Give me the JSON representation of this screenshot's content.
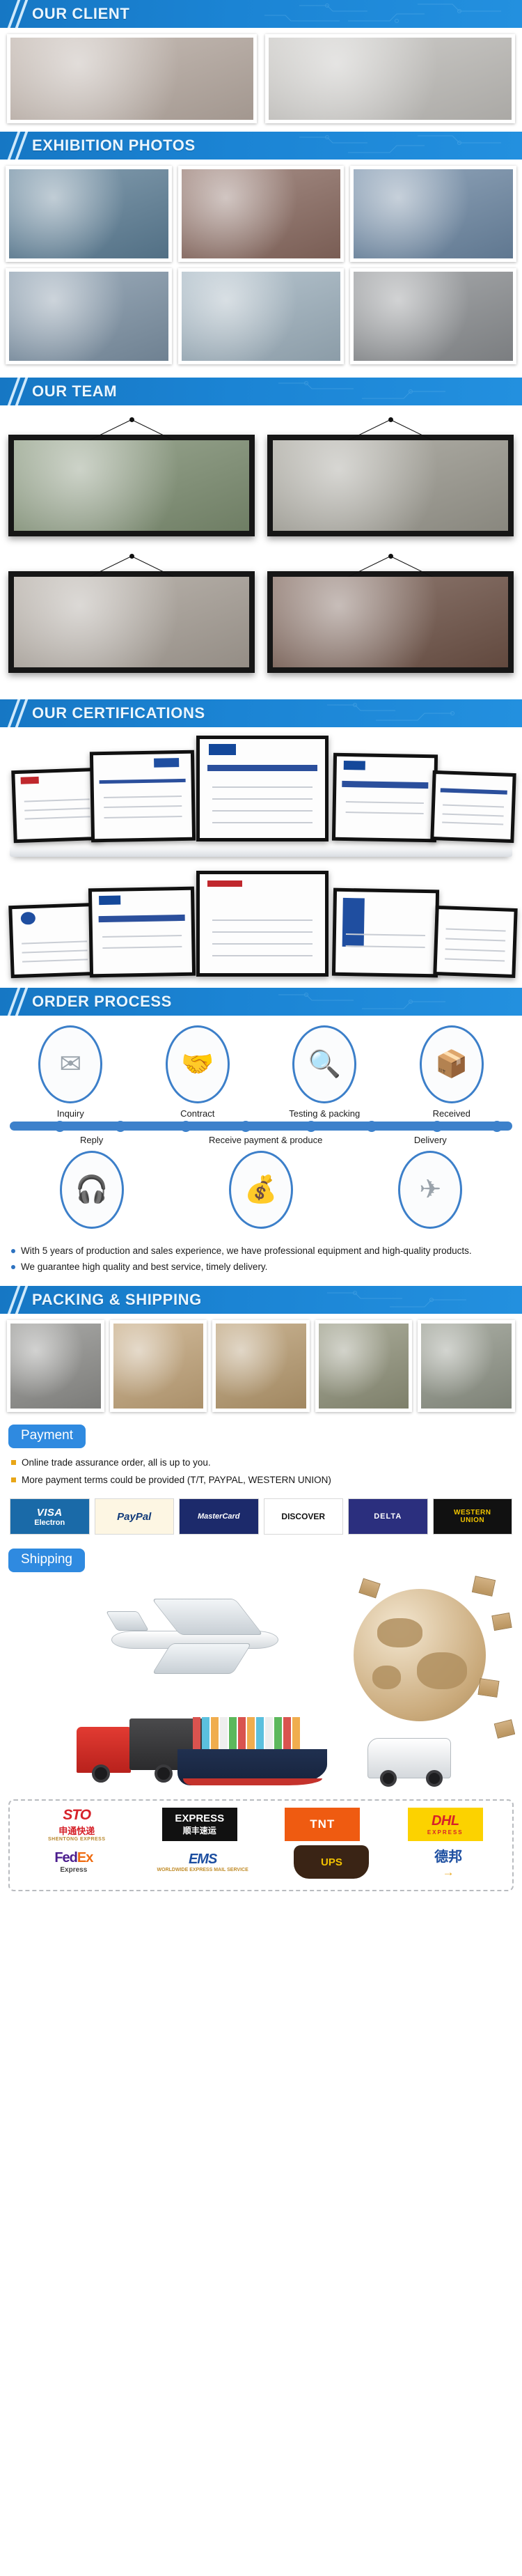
{
  "theme": {
    "header_blue": "#1b84d4",
    "accent_blue": "#2f8ae0",
    "process_blue": "#3d81cb",
    "bullet_gold": "#e8a617"
  },
  "sections": {
    "client": {
      "title": "OUR CLIENT"
    },
    "exhibition": {
      "title": "EXHIBITION PHOTOS"
    },
    "team": {
      "title": "OUR TEAM"
    },
    "certifications": {
      "title": "OUR CERTIFICATIONS"
    },
    "order_process": {
      "title": "ORDER PROCESS"
    },
    "packing": {
      "title": "PACKING & SHIPPING"
    }
  },
  "client_photos": [
    {
      "caption": "client-meeting-photo-1"
    },
    {
      "caption": "client-group-photo-2"
    }
  ],
  "exhibition_photos": [
    {
      "caption": "booth-guangdong-flight-electric"
    },
    {
      "caption": "trade-show-aisle-visitors"
    },
    {
      "caption": "booth-staff-three-people"
    },
    {
      "caption": "booth-visitors-crowd"
    },
    {
      "caption": "booth-product-display"
    },
    {
      "caption": "exhibition-hall-crowd"
    }
  ],
  "team_photos": [
    {
      "caption": "team-trip-2018-changlong-banner"
    },
    {
      "caption": "team-outing-temple-group"
    },
    {
      "caption": "team-dinner-blue-uniform"
    },
    {
      "caption": "team-baishui-village-2020-banner"
    }
  ],
  "certificate_rows": [
    [
      {
        "label": "DECLARATION OF CONFORMITY"
      },
      {
        "label": "CERTIFICATE"
      },
      {
        "label": "IEC CB TEST CERTIFICATE"
      },
      {
        "label": "IEC CB TEST CERTIFICATE"
      },
      {
        "label": "CB TEST CERTIFICATE"
      }
    ],
    [
      {
        "label": "ISO 9001 QUALITY MANAGEMENT"
      },
      {
        "label": "IEC CB TEST CERTIFICATE"
      },
      {
        "label": "CERTIFICATE of Conformity"
      },
      {
        "label": "CERTIFICATE"
      },
      {
        "label": "CHINA CCC CERTIFICATE"
      }
    ]
  ],
  "order_process": {
    "top_steps": [
      {
        "label": "Inquiry",
        "icon": "email-at-icon"
      },
      {
        "label": "Contract",
        "icon": "handshake-contract-icon"
      },
      {
        "label": "Testing & packing",
        "icon": "inspection-packing-icon"
      },
      {
        "label": "Received",
        "icon": "warehouse-delivery-icon"
      }
    ],
    "bottom_steps": [
      {
        "label": "Reply",
        "icon": "headset-support-icon"
      },
      {
        "label": "Receive payment & produce",
        "icon": "payment-production-icon"
      },
      {
        "label": "Delivery",
        "icon": "air-freight-globe-icon"
      }
    ],
    "bullets": [
      "With 5 years of production and sales experience, we have professional equipment and high-quality products.",
      "We guarantee high quality and best service, timely delivery."
    ]
  },
  "packing_photos": [
    {
      "caption": "bubble-wrap-bagged-parts"
    },
    {
      "caption": "carton-filled-with-units"
    },
    {
      "caption": "sealed-carton-on-floor"
    },
    {
      "caption": "wrapped-pallet-bundle"
    },
    {
      "caption": "stacked-pallet-shrinkwrapped"
    }
  ],
  "payment": {
    "label": "Payment",
    "bullets": [
      "Online trade assurance order, all is up to you.",
      "More payment terms could be provided (T/T, PAYPAL, WESTERN UNION)"
    ],
    "logos": [
      {
        "name": "visa-electron-logo",
        "line1": "VISA",
        "line2": "Electron"
      },
      {
        "name": "paypal-logo",
        "line1": "PayPal",
        "line2": ""
      },
      {
        "name": "mastercard-logo",
        "line1": "MasterCard",
        "line2": ""
      },
      {
        "name": "discover-logo",
        "line1": "DISCOVER",
        "line2": ""
      },
      {
        "name": "delta-logo",
        "line1": "DELTA",
        "line2": ""
      },
      {
        "name": "western-union-logo",
        "line1": "WESTERN",
        "line2": "UNION"
      }
    ]
  },
  "shipping": {
    "label": "Shipping",
    "illustration": "air-sea-road-freight-globe",
    "carriers_row1": [
      {
        "name": "sto-express-logo",
        "a": "STO",
        "b": "申通快递",
        "c": "SHENTONG EXPRESS"
      },
      {
        "name": "sf-express-logo",
        "a": "EXPRESS",
        "b": "顺丰速运",
        "c": ""
      },
      {
        "name": "tnt-logo",
        "a": "TNT",
        "b": "",
        "c": ""
      },
      {
        "name": "dhl-express-logo",
        "a": "DHL",
        "b": "EXPRESS",
        "c": ""
      }
    ],
    "carriers_row2": [
      {
        "name": "fedex-express-logo",
        "a": "FedEx",
        "b": "Express",
        "c": ""
      },
      {
        "name": "ems-logo",
        "a": "EMS",
        "b": "WORLDWIDE EXPRESS MAIL SERVICE",
        "c": ""
      },
      {
        "name": "ups-logo",
        "a": "UPS",
        "b": "",
        "c": ""
      },
      {
        "name": "deppon-logo",
        "a": "德邦",
        "b": "→",
        "c": ""
      }
    ]
  }
}
